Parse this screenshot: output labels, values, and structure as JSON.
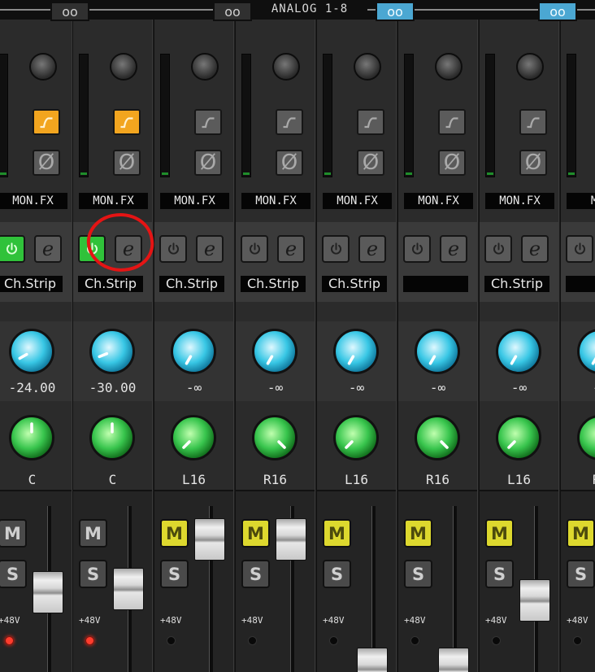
{
  "section": {
    "title": "ANALOG 1-8"
  },
  "channels": [
    {
      "fx_label": "MON.FX",
      "strip_label": "Ch.Strip",
      "strip_power": "on",
      "level": "-24.00",
      "pan": "C",
      "mute": "off",
      "phantom": "on"
    },
    {
      "fx_label": "MON.FX",
      "strip_label": "Ch.Strip",
      "strip_power": "on",
      "level": "-30.00",
      "pan": "C",
      "mute": "off",
      "phantom": "on"
    },
    {
      "fx_label": "MON.FX",
      "strip_label": "Ch.Strip",
      "strip_power": "off",
      "level": "-∞",
      "pan": "L16",
      "mute": "on",
      "phantom": "off"
    },
    {
      "fx_label": "MON.FX",
      "strip_label": "Ch.Strip",
      "strip_power": "off",
      "level": "-∞",
      "pan": "R16",
      "mute": "on",
      "phantom": "off"
    },
    {
      "fx_label": "MON.FX",
      "strip_label": "Ch.Strip",
      "strip_power": "off",
      "level": "-∞",
      "pan": "L16",
      "mute": "on",
      "phantom": "off"
    },
    {
      "fx_label": "MON.FX",
      "strip_label": "",
      "strip_power": "off",
      "level": "-∞",
      "pan": "R16",
      "mute": "on",
      "phantom": "off"
    },
    {
      "fx_label": "MON.FX",
      "strip_label": "Ch.Strip",
      "strip_power": "off",
      "level": "-∞",
      "pan": "L16",
      "mute": "on",
      "phantom": "off"
    },
    {
      "fx_label": "MON",
      "strip_label": "",
      "strip_power": "off",
      "level": "-∞",
      "pan": "R1",
      "mute": "on",
      "phantom": "off"
    }
  ],
  "controls": {
    "mute_label": "M",
    "solo_label": "S",
    "phantom_label": "+48V",
    "edit_label": "e",
    "phase_symbol": "Ø",
    "link_symbol": "oo"
  },
  "icons": {
    "phones": "headphones-icon",
    "power": "power-icon",
    "edit": "edit-icon",
    "hpf": "high-pass-filter-icon",
    "phase": "phase-invert-icon",
    "link": "stereo-link-icon"
  },
  "colors": {
    "mute_active": "#ddd82e",
    "strip_power_active": "#30c23a",
    "hpf_active": "#f2a51f",
    "link_active": "#4ba7d2",
    "phantom_led_on": "#ff3d2d",
    "highlight": "#e51414"
  }
}
